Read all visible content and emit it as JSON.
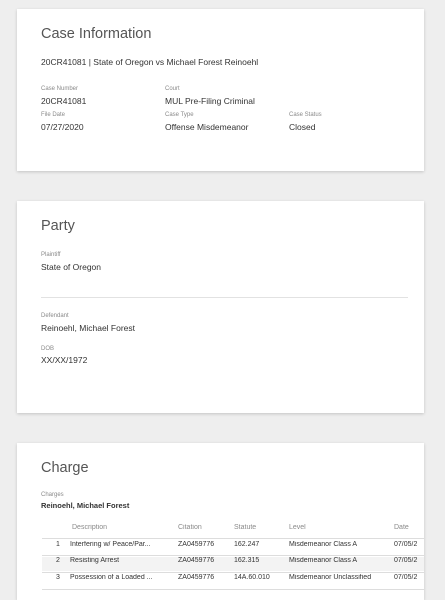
{
  "case": {
    "title": "Case Information",
    "headline": "20CR41081 | State of Oregon vs Michael Forest Reinoehl",
    "case_number_label": "Case Number",
    "case_number": "20CR41081",
    "court_label": "Court",
    "court": "MUL Pre-Filing Criminal",
    "file_date_label": "File Date",
    "file_date": "07/27/2020",
    "case_type_label": "Case Type",
    "case_type": "Offense Misdemeanor",
    "case_status_label": "Case Status",
    "case_status": "Closed"
  },
  "party": {
    "title": "Party",
    "plaintiff_label": "Plaintiff",
    "plaintiff": "State of Oregon",
    "defendant_label": "Defendant",
    "defendant": "Reinoehl, Michael Forest",
    "dob_label": "DOB",
    "dob": "XX/XX/1972"
  },
  "charge": {
    "title": "Charge",
    "charges_label": "Charges",
    "charges_party": "Reinoehl, Michael Forest",
    "columns": {
      "description": "Description",
      "citation": "Citation",
      "statute": "Statute",
      "level": "Level",
      "date": "Date"
    },
    "rows": [
      {
        "num": "1",
        "description": "Interfering w/ Peace/Par...",
        "citation": "ZA0459776",
        "statute": "162.247",
        "level": "Misdemeanor Class A",
        "date": "07/05/2"
      },
      {
        "num": "2",
        "description": "Resisting Arrest",
        "citation": "ZA0459776",
        "statute": "162.315",
        "level": "Misdemeanor Class A",
        "date": "07/05/2"
      },
      {
        "num": "3",
        "description": "Possession of a Loaded ...",
        "citation": "ZA0459776",
        "statute": "14A.60.010",
        "level": "Misdemeanor Unclassified",
        "date": "07/05/2"
      }
    ]
  }
}
